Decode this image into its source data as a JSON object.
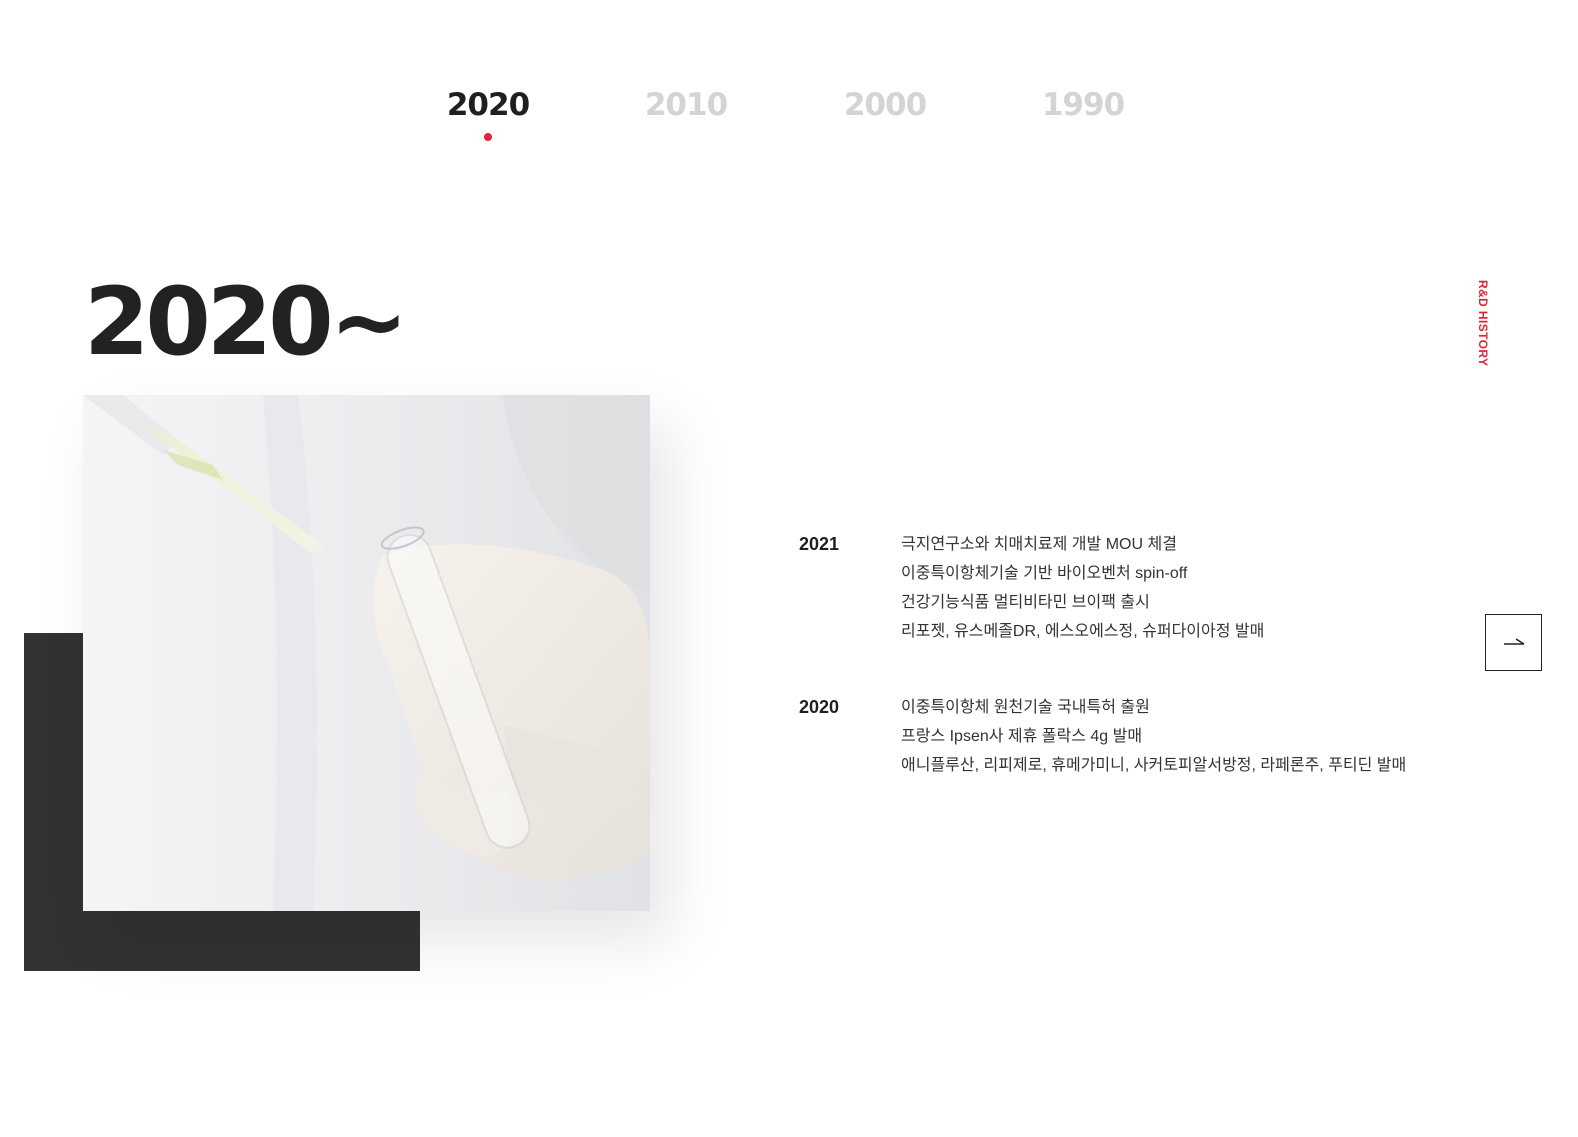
{
  "tabs": [
    {
      "label": "2020",
      "active": true
    },
    {
      "label": "2010",
      "active": false
    },
    {
      "label": "2000",
      "active": false
    },
    {
      "label": "1990",
      "active": false
    }
  ],
  "side_label": "R&D HISTORY",
  "decade_title": "2020~",
  "timeline": [
    {
      "year": "2021",
      "events": [
        "극지연구소와 치매치료제 개발 MOU 체결",
        "이중특이항체기술 기반 바이오벤처 spin-off",
        "건강기능식품 멀티비타민 브이팩 출시",
        "리포젯, 유스메졸DR, 에스오에스정, 슈퍼다이아정 발매"
      ]
    },
    {
      "year": "2020",
      "events": [
        "이중특이항체 원천기술 국내특허 출원",
        "프랑스 Ipsen사 제휴 폴락스 4g 발매",
        "애니플루산, 리피제로, 휴메가미니, 사커토피알서방정, 라페론주, 푸티딘 발매"
      ]
    }
  ],
  "colors": {
    "accent": "#e0233a",
    "dark_block": "#323234",
    "inactive_tab": "#d4d4d4",
    "text": "#222222"
  },
  "icons": {
    "next": "arrow-right-icon"
  }
}
